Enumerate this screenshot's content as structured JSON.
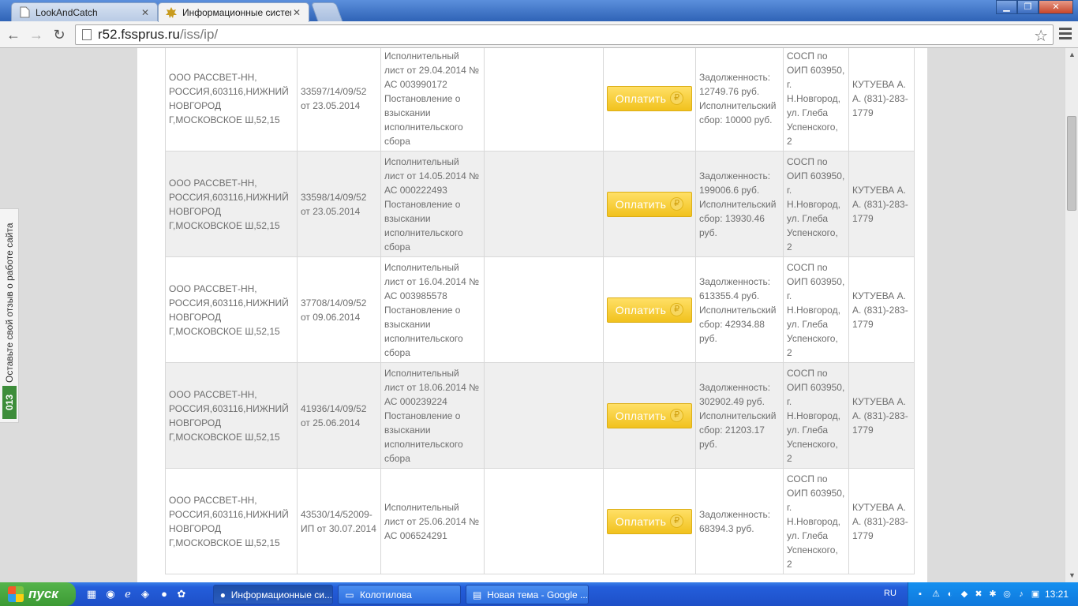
{
  "browser": {
    "tabs": [
      {
        "label": "LookAndCatch",
        "favicon": "page-icon",
        "active": false
      },
      {
        "label": "Информационные системы",
        "favicon": "fssp-emblem-icon",
        "active": true
      }
    ],
    "url_host": "r52.fssprus.ru",
    "url_path": "/iss/ip/"
  },
  "feedback": {
    "text": "Оставьте свой отзыв о работе сайта",
    "badge": "013"
  },
  "pay_label": "Оплатить",
  "pay_currency": "₽",
  "rows": [
    {
      "debtor": "ООО РАССВЕТ-НН, РОССИЯ,603116,НИЖНИЙ НОВГОРОД Г,МОСКОВСКОЕ Ш,52,15",
      "proceeding": "33597/14/09/52 от 23.05.2014",
      "document": "Исполнительный лист от 29.04.2014 № АС 003990172 Постановление о взыскании исполнительского сбора",
      "end_reason": "",
      "debt": "Задолженность: 12749.76 руб. Исполнительский сбор: 10000 руб.",
      "department": "СОСП по ОИП 603950, г. Н.Новгород, ул. Глеба Успенского, 2",
      "officer": "КУТУЕВА А. А. (831)-283-1779"
    },
    {
      "debtor": "ООО РАССВЕТ-НН, РОССИЯ,603116,НИЖНИЙ НОВГОРОД Г,МОСКОВСКОЕ Ш,52,15",
      "proceeding": "33598/14/09/52 от 23.05.2014",
      "document": "Исполнительный лист от 14.05.2014 № АС 000222493 Постановление о взыскании исполнительского сбора",
      "end_reason": "",
      "debt": "Задолженность: 199006.6 руб. Исполнительский сбор: 13930.46 руб.",
      "department": "СОСП по ОИП 603950, г. Н.Новгород, ул. Глеба Успенского, 2",
      "officer": "КУТУЕВА А. А. (831)-283-1779"
    },
    {
      "debtor": "ООО РАССВЕТ-НН, РОССИЯ,603116,НИЖНИЙ НОВГОРОД Г,МОСКОВСКОЕ Ш,52,15",
      "proceeding": "37708/14/09/52 от 09.06.2014",
      "document": "Исполнительный лист от 16.04.2014 № АС 003985578 Постановление о взыскании исполнительского сбора",
      "end_reason": "",
      "debt": "Задолженность: 613355.4 руб. Исполнительский сбор: 42934.88 руб.",
      "department": "СОСП по ОИП 603950, г. Н.Новгород, ул. Глеба Успенского, 2",
      "officer": "КУТУЕВА А. А. (831)-283-1779"
    },
    {
      "debtor": "ООО РАССВЕТ-НН, РОССИЯ,603116,НИЖНИЙ НОВГОРОД Г,МОСКОВСКОЕ Ш,52,15",
      "proceeding": "41936/14/09/52 от 25.06.2014",
      "document": "Исполнительный лист от 18.06.2014 № АС 000239224 Постановление о взыскании исполнительского сбора",
      "end_reason": "",
      "debt": "Задолженность: 302902.49 руб. Исполнительский сбор: 21203.17 руб.",
      "department": "СОСП по ОИП 603950, г. Н.Новгород, ул. Глеба Успенского, 2",
      "officer": "КУТУЕВА А. А. (831)-283-1779"
    },
    {
      "debtor": "ООО РАССВЕТ-НН, РОССИЯ,603116,НИЖНИЙ НОВГОРОД Г,МОСКОВСКОЕ Ш,52,15",
      "proceeding": "43530/14/52009-ИП от 30.07.2014",
      "document": "Исполнительный лист от 25.06.2014 № АС 006524291",
      "end_reason": "",
      "debt": "Задолженность: 68394.3 руб.",
      "department": "СОСП по ОИП 603950, г. Н.Новгород, ул. Глеба Успенского, 2",
      "officer": "КУТУЕВА А. А. (831)-283-1779"
    }
  ],
  "taskbar": {
    "start_label": "пуск",
    "tasks": [
      {
        "label": "Информационные си...",
        "icon": "chrome-icon",
        "active": true
      },
      {
        "label": "Колотилова",
        "icon": "folder-icon",
        "active": false
      },
      {
        "label": "Новая тема - Google ...",
        "icon": "document-icon",
        "active": false
      }
    ],
    "language": "RU",
    "clock": "13:21"
  },
  "colors": {
    "pay_button": "#f4c92a",
    "row_alt": "#efefef",
    "taskbar": "#245edb",
    "start": "#3c9a34",
    "feedback_badge": "#3d8d3a"
  }
}
